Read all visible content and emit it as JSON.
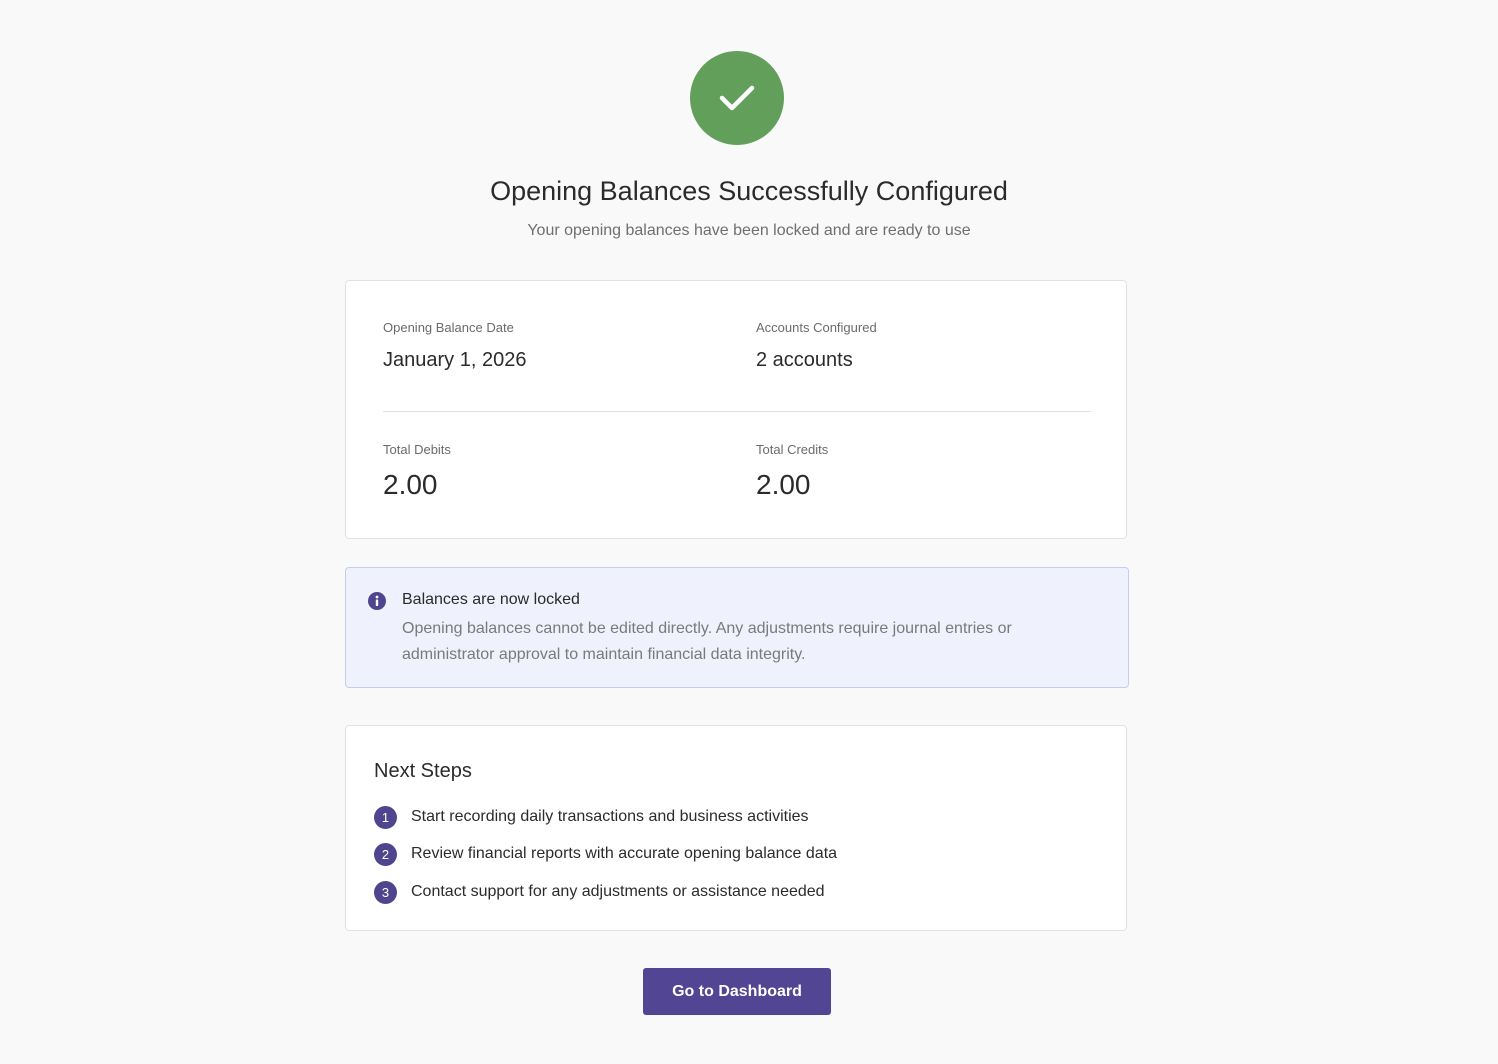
{
  "header": {
    "title": "Opening Balances Successfully Configured",
    "subtitle": "Your opening balances have been locked and are ready to use"
  },
  "summary": {
    "opening_date_label": "Opening Balance Date",
    "opening_date_value": "January 1, 2026",
    "accounts_label": "Accounts Configured",
    "accounts_value": "2 accounts",
    "debits_label": "Total Debits",
    "debits_value": "2.00",
    "credits_label": "Total Credits",
    "credits_value": "2.00"
  },
  "notice": {
    "title": "Balances are now locked",
    "text": "Opening balances cannot be edited directly. Any adjustments require journal entries or administrator approval to maintain financial data integrity."
  },
  "next_steps": {
    "title": "Next Steps",
    "items": [
      {
        "number": "1",
        "text": "Start recording daily transactions and business activities"
      },
      {
        "number": "2",
        "text": "Review financial reports with accurate opening balance data"
      },
      {
        "number": "3",
        "text": "Contact support for any adjustments or assistance needed"
      }
    ]
  },
  "actions": {
    "dashboard_label": "Go to Dashboard"
  },
  "icons": {
    "success": "checkmark-icon",
    "info": "info-icon"
  },
  "colors": {
    "success": "#629f5a",
    "accent": "#524594",
    "info_bg": "#eff1fc"
  }
}
